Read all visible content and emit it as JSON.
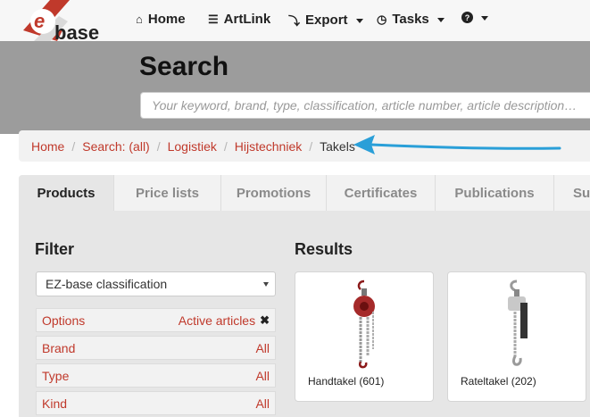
{
  "brand": {
    "logo_text": "EZbase",
    "logo_color": "#c0392b"
  },
  "nav": {
    "items": [
      {
        "label": "Home",
        "icon": "home-icon"
      },
      {
        "label": "ArtLink",
        "icon": "list-icon"
      },
      {
        "label": "Export",
        "icon": "upload-icon"
      },
      {
        "label": "Tasks",
        "icon": "clock-icon"
      },
      {
        "label": "",
        "icon": "help-icon"
      }
    ]
  },
  "header": {
    "title": "Search",
    "search_placeholder": "Your keyword, brand, type, classification, article number, article description…"
  },
  "breadcrumb": [
    "Home",
    "Search: (all)",
    "Logistiek",
    "Hijstechniek",
    "Takels"
  ],
  "tabs": [
    "Products",
    "Price lists",
    "Promotions",
    "Certificates",
    "Publications",
    "Su"
  ],
  "filter": {
    "title": "Filter",
    "classification": "EZ-base classification",
    "rows": [
      {
        "label": "Options",
        "value": "Active articles"
      },
      {
        "label": "Brand",
        "value": "All"
      },
      {
        "label": "Type",
        "value": "All"
      },
      {
        "label": "Kind",
        "value": "All"
      }
    ]
  },
  "results": {
    "title": "Results",
    "cards": [
      {
        "label": "Handtakel (601)"
      },
      {
        "label": "Rateltakel (202)"
      }
    ]
  },
  "colors": {
    "accent": "#c0392b",
    "arrow": "#2a9fd8",
    "header_bg": "#9c9c9c"
  }
}
